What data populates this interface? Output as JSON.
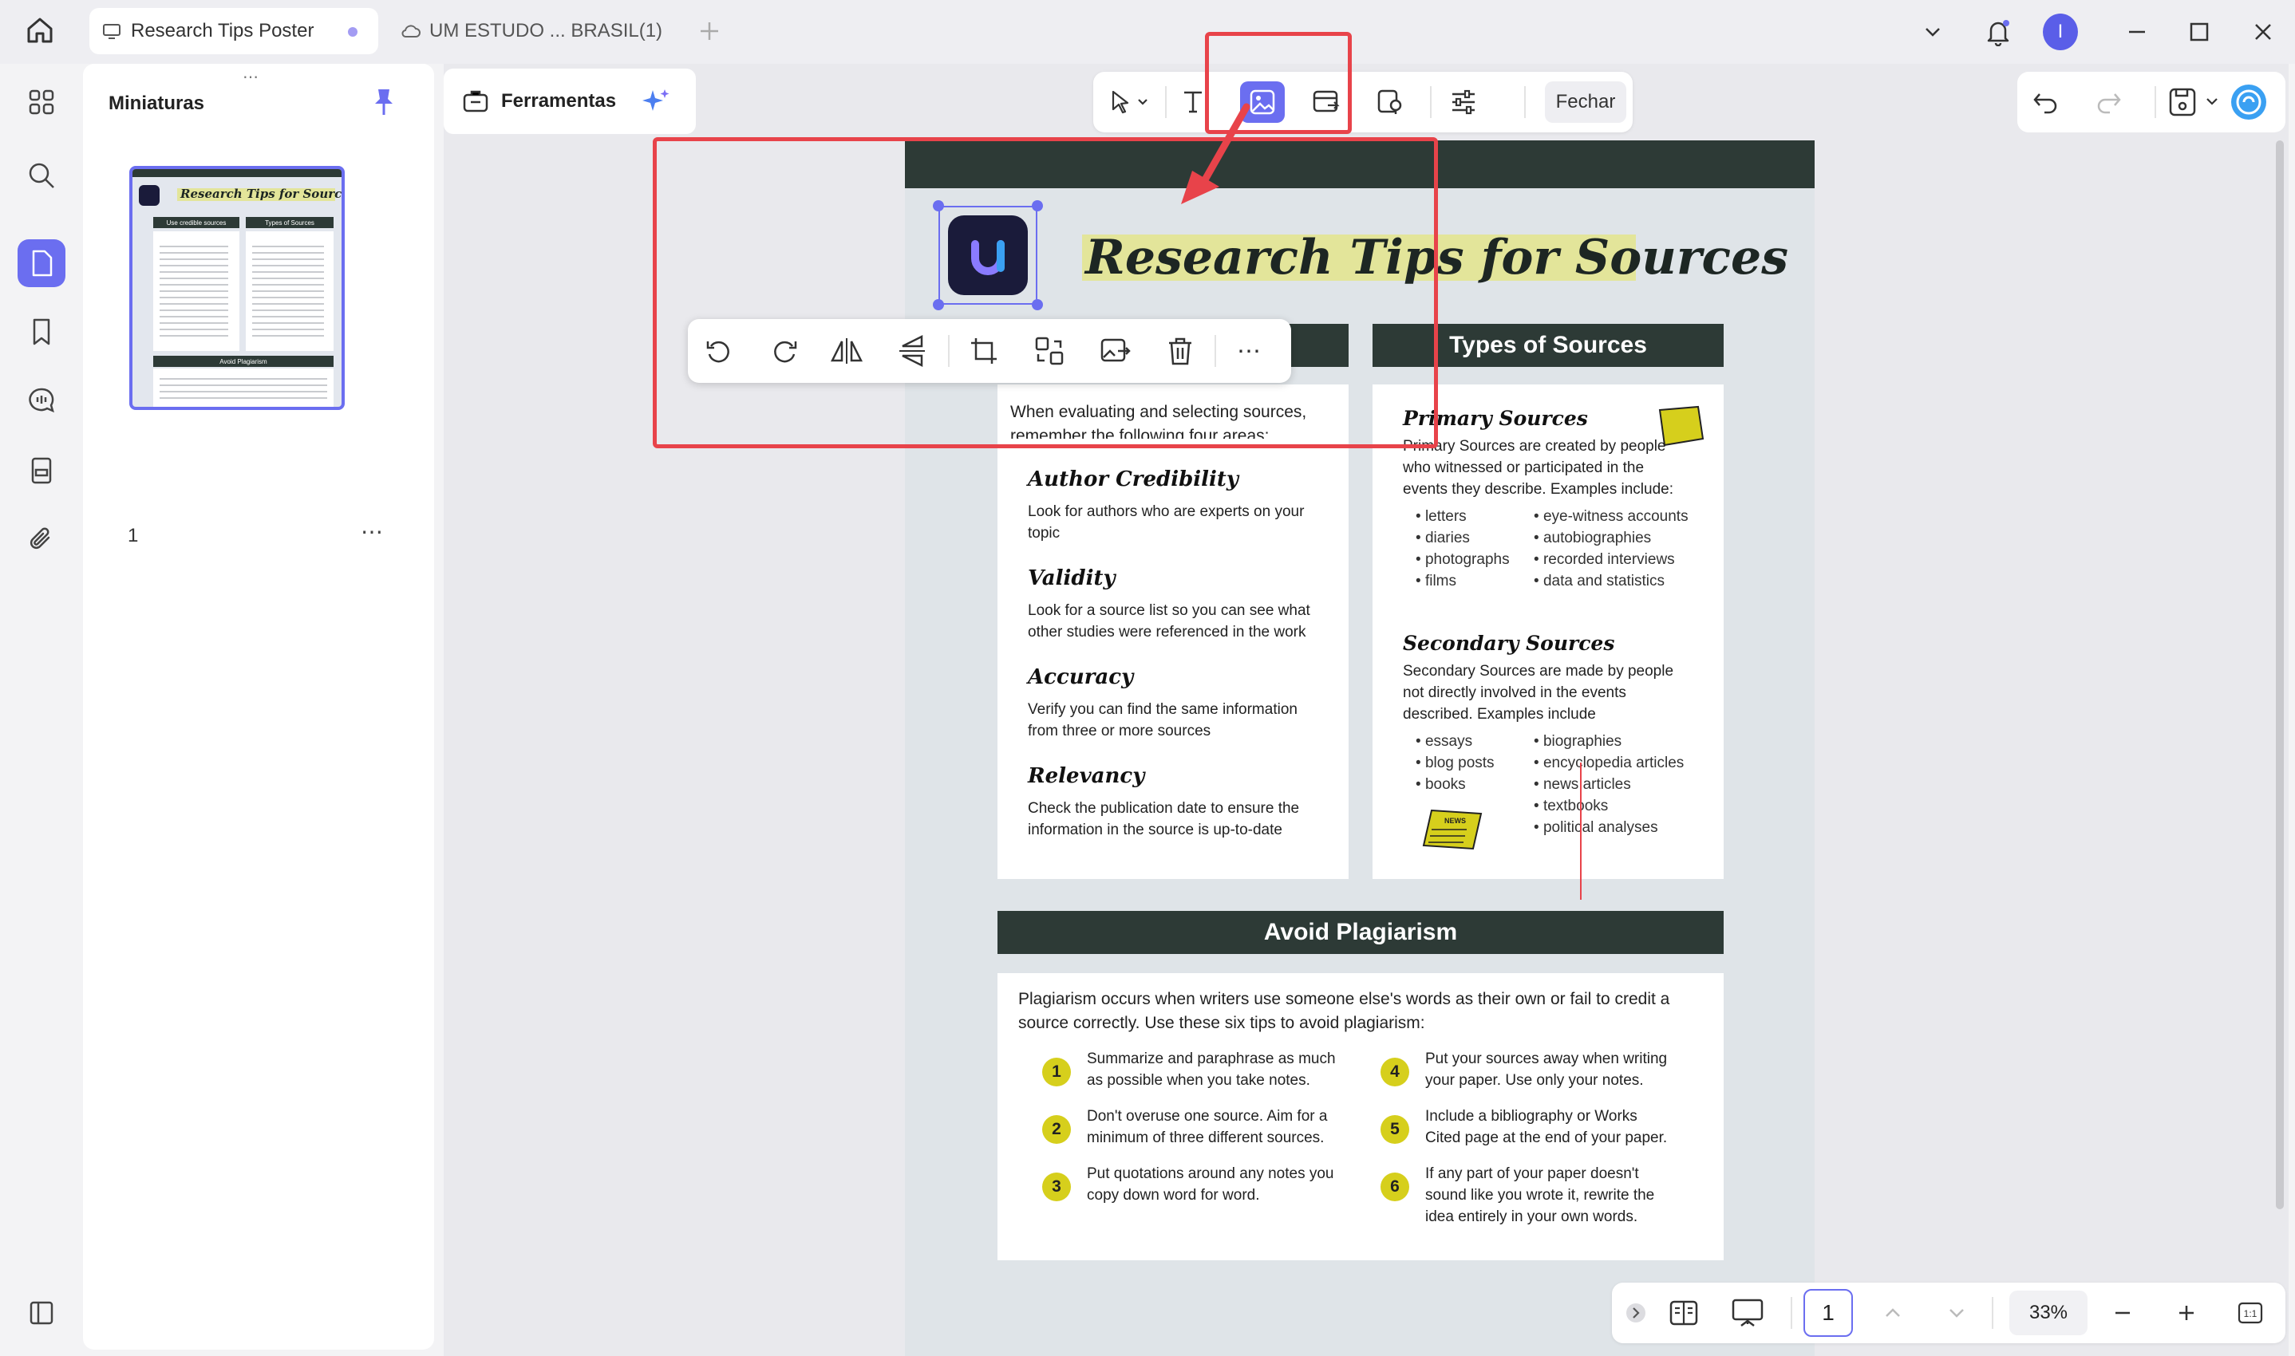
{
  "tabs": [
    {
      "label": "Research Tips Poster",
      "active": true
    },
    {
      "label": "UM ESTUDO ... BRASIL(1)",
      "active": false
    }
  ],
  "user_avatar_letter": "I",
  "sidebar": {
    "panel_title": "Miniaturas",
    "page_number": "1"
  },
  "toolbar": {
    "tools_label": "Ferramentas",
    "close_label": "Fechar"
  },
  "poster": {
    "title": "Research Tips for Sources",
    "types_header": "Types of Sources",
    "intro": [
      "When evaluating and selecting sources,",
      "remember the following four areas:"
    ],
    "areas": [
      {
        "title": "Author Credibility",
        "lines": [
          "Look for authors who are experts on your",
          "topic"
        ]
      },
      {
        "title": "Validity",
        "lines": [
          "Look for a source list so you can see what",
          "other studies were referenced in the work"
        ]
      },
      {
        "title": "Accuracy",
        "lines": [
          "Verify you can find the same information",
          "from three or more sources"
        ]
      },
      {
        "title": "Relevancy",
        "lines": [
          "Check the publication date to ensure the",
          "information in the source is up-to-date"
        ]
      }
    ],
    "primary": {
      "title": "Primary Sources",
      "lines": [
        "Primary Sources are created by people",
        "who witnessed or participated in the",
        "events they describe. Examples include:"
      ],
      "col1": [
        "letters",
        "diaries",
        "photographs",
        "films"
      ],
      "col2": [
        "eye-witness accounts",
        "autobiographies",
        "recorded interviews",
        "data and statistics"
      ]
    },
    "secondary": {
      "title": "Secondary Sources",
      "lines": [
        "Secondary Sources are made by people",
        "not directly involved in the events",
        "described. Examples include"
      ],
      "col1": [
        "essays",
        "blog posts",
        "books"
      ],
      "col2": [
        "biographies",
        "encyclopedia articles",
        "news articles",
        "textbooks",
        "political analyses"
      ]
    },
    "news_label": "NEWS",
    "plagiarism_header": "Avoid Plagiarism",
    "plagiarism_intro": [
      "Plagiarism occurs when writers use someone else's words as their own or fail to credit a",
      "source correctly. Use these six tips to avoid plagiarism:"
    ],
    "tips": [
      {
        "n": "1",
        "lines": [
          "Summarize and paraphrase as much",
          "as possible when you take notes."
        ]
      },
      {
        "n": "2",
        "lines": [
          "Don't overuse one source. Aim for a",
          "minimum of three different sources."
        ]
      },
      {
        "n": "3",
        "lines": [
          "Put quotations around any notes you",
          "copy down word for word."
        ]
      },
      {
        "n": "4",
        "lines": [
          "Put your sources away when writing",
          "your paper. Use only your notes."
        ]
      },
      {
        "n": "5",
        "lines": [
          "Include a bibliography or Works",
          "Cited page at the end of your paper."
        ]
      },
      {
        "n": "6",
        "lines": [
          "If any part of your paper doesn't",
          "sound like you wrote it, rewrite the",
          "idea entirely in your own words."
        ]
      }
    ]
  },
  "thumbnail": {
    "title": "Research Tips for Sources",
    "left_header": "Use credible sources",
    "right_header": "Types of Sources",
    "bottom_header": "Avoid Plagiarism"
  },
  "bottom": {
    "page_value": "1",
    "zoom": "33%"
  },
  "colors": {
    "accent": "#6b6ef0",
    "poster_dark": "#2d3a36",
    "poster_highlight": "#e3e59a",
    "annotation_red": "#e8434a",
    "tip_yellow": "#d6cf1c"
  }
}
